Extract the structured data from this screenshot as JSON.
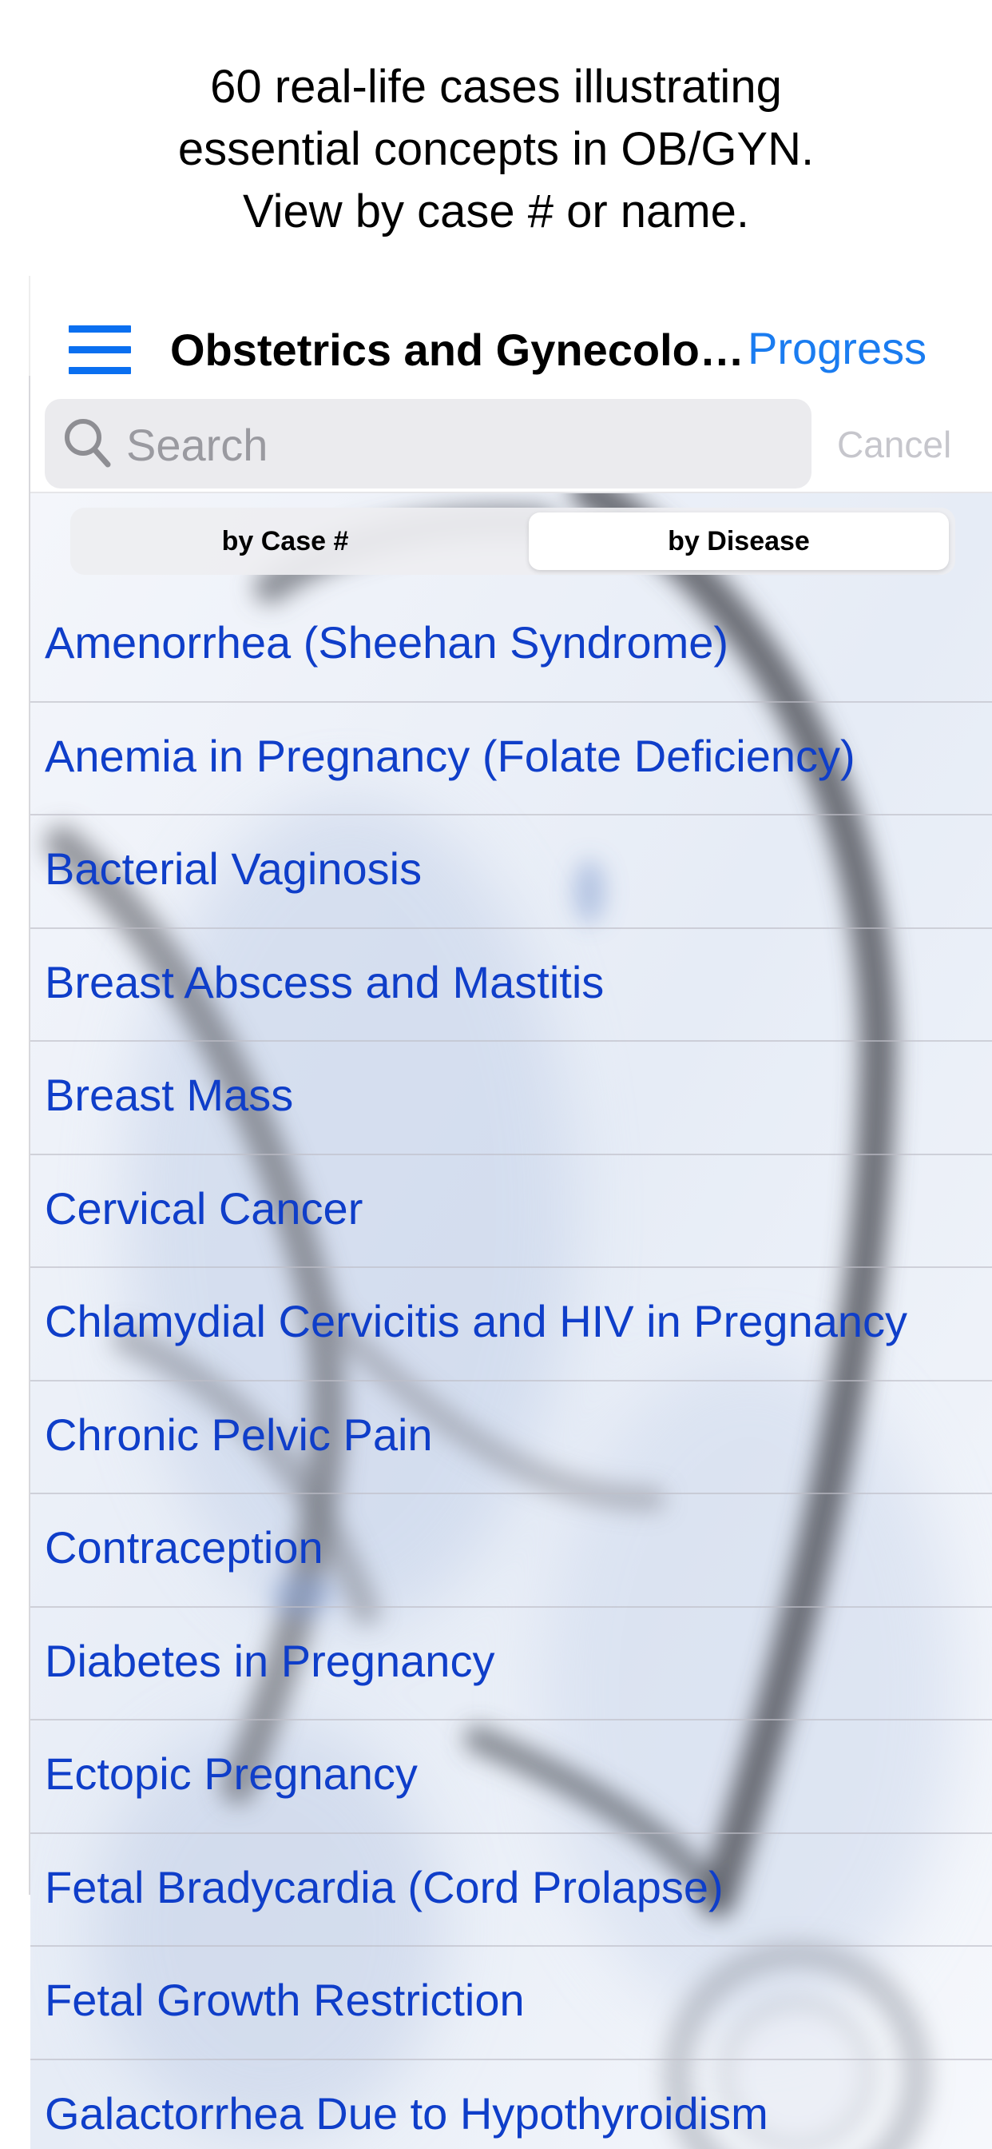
{
  "caption": {
    "line1": "60 real-life cases illustrating",
    "line2": "essential concepts in OB/GYN.",
    "line3": "View by case # or name."
  },
  "navbar": {
    "menu_icon": "hamburger-menu-icon",
    "title": "Obstetrics and Gynecolo…",
    "progress_label": "Progress"
  },
  "search": {
    "icon": "magnifying-glass-icon",
    "placeholder": "Search",
    "value": "",
    "cancel_label": "Cancel"
  },
  "segments": {
    "by_case": "by Case #",
    "by_disease": "by Disease",
    "selected": "by Disease"
  },
  "cases": [
    "Amenorrhea (Sheehan Syndrome)",
    "Anemia in Pregnancy (Folate Deficiency)",
    "Bacterial Vaginosis",
    "Breast Abscess and Mastitis",
    "Breast Mass",
    "Cervical Cancer",
    "Chlamydial Cervicitis and HIV in Pregnancy",
    "Chronic Pelvic Pain",
    "Contraception",
    "Diabetes in Pregnancy",
    "Ectopic Pregnancy",
    "Fetal Bradycardia (Cord Prolapse)",
    "Fetal Growth Restriction",
    "Galactorrhea Due to Hypothyroidism"
  ],
  "colors": {
    "accent": "#1a7cf0",
    "list_text": "#0f3ec9",
    "muted": "#c6c6cc"
  }
}
